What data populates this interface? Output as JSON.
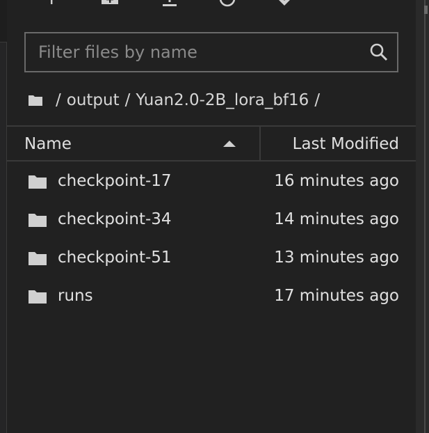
{
  "toolbar": {
    "buttons": [
      {
        "name": "new-launcher-button",
        "icon": "plus-icon"
      },
      {
        "name": "new-folder-button",
        "icon": "new-folder-icon"
      },
      {
        "name": "upload-button",
        "icon": "upload-icon"
      },
      {
        "name": "refresh-button",
        "icon": "refresh-icon"
      },
      {
        "name": "git-clone-button",
        "icon": "git-clone-icon"
      }
    ]
  },
  "filter": {
    "placeholder": "Filter files by name",
    "value": ""
  },
  "breadcrumbs": {
    "root_icon": "folder-icon",
    "separator": "/",
    "items": [
      "output",
      "Yuan2.0-2B_lora_bf16"
    ]
  },
  "listing": {
    "header": {
      "name_label": "Name",
      "modified_label": "Last Modified",
      "sort": "ascending"
    },
    "items": [
      {
        "type": "folder",
        "name": "checkpoint-17",
        "modified": "16 minutes ago"
      },
      {
        "type": "folder",
        "name": "checkpoint-34",
        "modified": "14 minutes ago"
      },
      {
        "type": "folder",
        "name": "checkpoint-51",
        "modified": "13 minutes ago"
      },
      {
        "type": "folder",
        "name": "runs",
        "modified": "17 minutes ago"
      }
    ]
  },
  "colors": {
    "panel_bg": "#212121",
    "text": "#e0e0e0",
    "placeholder": "#8a8a8a",
    "border": "#6a6a6a",
    "icon": "#d0d0d0"
  }
}
